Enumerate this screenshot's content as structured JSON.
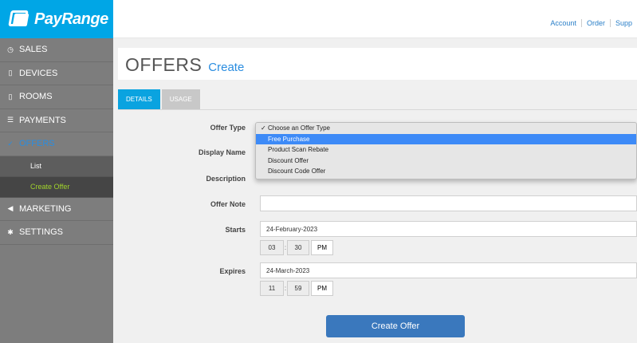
{
  "brand": {
    "name": "PayRange"
  },
  "topbar": {
    "links": [
      "Account",
      "Order",
      "Supp"
    ]
  },
  "sidebar": {
    "items": [
      {
        "label": "SALES",
        "icon": "clock-icon"
      },
      {
        "label": "DEVICES",
        "icon": "phone-icon"
      },
      {
        "label": "ROOMS",
        "icon": "phone-icon"
      },
      {
        "label": "PAYMENTS",
        "icon": "list-icon"
      },
      {
        "label": "OFFERS",
        "icon": "thumbs-up-icon"
      },
      {
        "label": "MARKETING",
        "icon": "megaphone-icon"
      },
      {
        "label": "SETTINGS",
        "icon": "gear-icon"
      }
    ],
    "offers_sub": [
      "List",
      "Create Offer"
    ]
  },
  "page": {
    "title": "OFFERS",
    "subtitle": "Create"
  },
  "tabs": [
    "DETAILS",
    "USAGE"
  ],
  "form": {
    "offer_type_label": "Offer Type",
    "display_name_label": "Display Name",
    "description_label": "Description",
    "offer_note_label": "Offer Note",
    "starts_label": "Starts",
    "starts_date": "24-February-2023",
    "starts_hour": "03",
    "starts_min": "30",
    "starts_ampm": "PM",
    "expires_label": "Expires",
    "expires_date": "24-March-2023",
    "expires_hour": "11",
    "expires_min": "59",
    "expires_ampm": "PM",
    "time_sep": ":",
    "submit_label": "Create Offer"
  },
  "dropdown": {
    "options": [
      "Choose an Offer Type",
      "Free Purchase",
      "Product Scan Rebate",
      "Discount Offer",
      "Discount Code Offer"
    ],
    "checked_glyph": "✓"
  },
  "colors": {
    "brand_blue": "#00a6e6",
    "accent_blue": "#2a8de0",
    "sub_active": "#a0d22c",
    "button": "#3a78bd"
  }
}
